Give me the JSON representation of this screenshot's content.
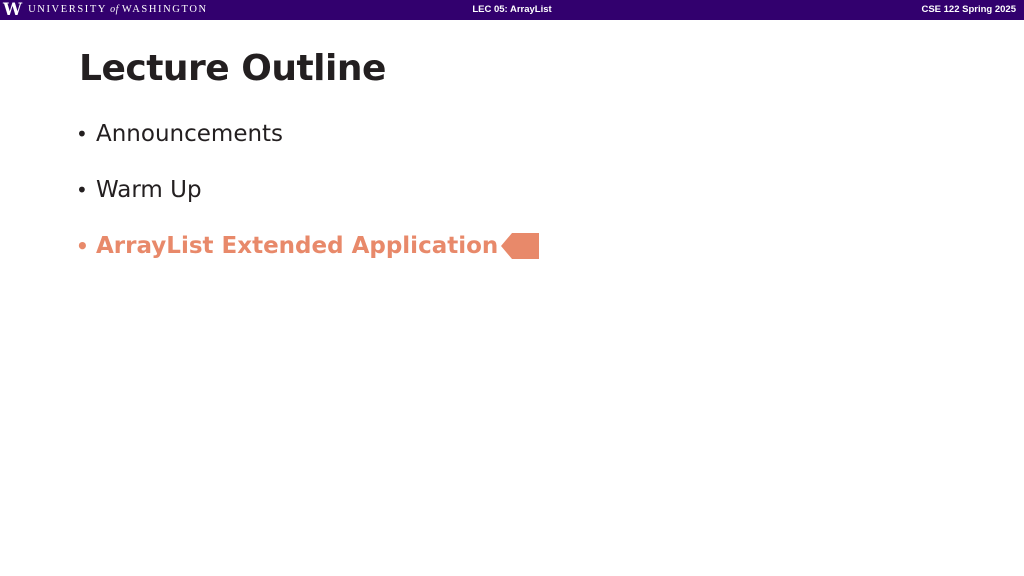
{
  "header": {
    "logo_mark": "W",
    "university_part1": "UNIVERSITY",
    "university_of": "of",
    "university_part2": "WASHINGTON",
    "lecture": "LEC 05: ArrayList",
    "course": "CSE 122 Spring 2025",
    "bar_color": "#32006e"
  },
  "slide": {
    "title": "Lecture Outline",
    "bullets": [
      {
        "text": "Announcements",
        "active": false
      },
      {
        "text": "Warm Up",
        "active": false
      },
      {
        "text": "ArrayList Extended Application",
        "active": true
      }
    ],
    "bullet_glyph": "•",
    "active_color": "#e8896a",
    "pointer_icon": "arrow-left-icon"
  }
}
